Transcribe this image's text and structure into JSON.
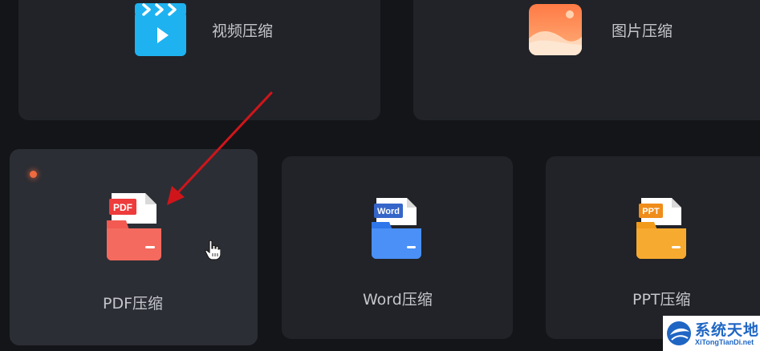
{
  "tools": {
    "video": {
      "label": "视频压缩",
      "icon": "video-clapperboard-icon"
    },
    "image": {
      "label": "图片压缩",
      "icon": "image-picture-icon"
    },
    "pdf": {
      "label": "PDF压缩",
      "icon": "pdf-file-icon",
      "badge": "PDF"
    },
    "word": {
      "label": "Word压缩",
      "icon": "word-file-icon",
      "badge": "Word"
    },
    "ppt": {
      "label": "PPT压缩",
      "icon": "ppt-file-icon",
      "badge": "PPT"
    }
  },
  "watermark": {
    "title": "系统天地",
    "url": "XiTongTianDi.net"
  },
  "colors": {
    "background": "#141519",
    "card": "#212328",
    "card_hover": "#2c2e35",
    "video_icon": "#1fb2f0",
    "pdf_icon": "#f25a52",
    "word_icon": "#3d86f5",
    "ppt_icon": "#f7a125",
    "annotation_arrow": "#d0151a"
  }
}
